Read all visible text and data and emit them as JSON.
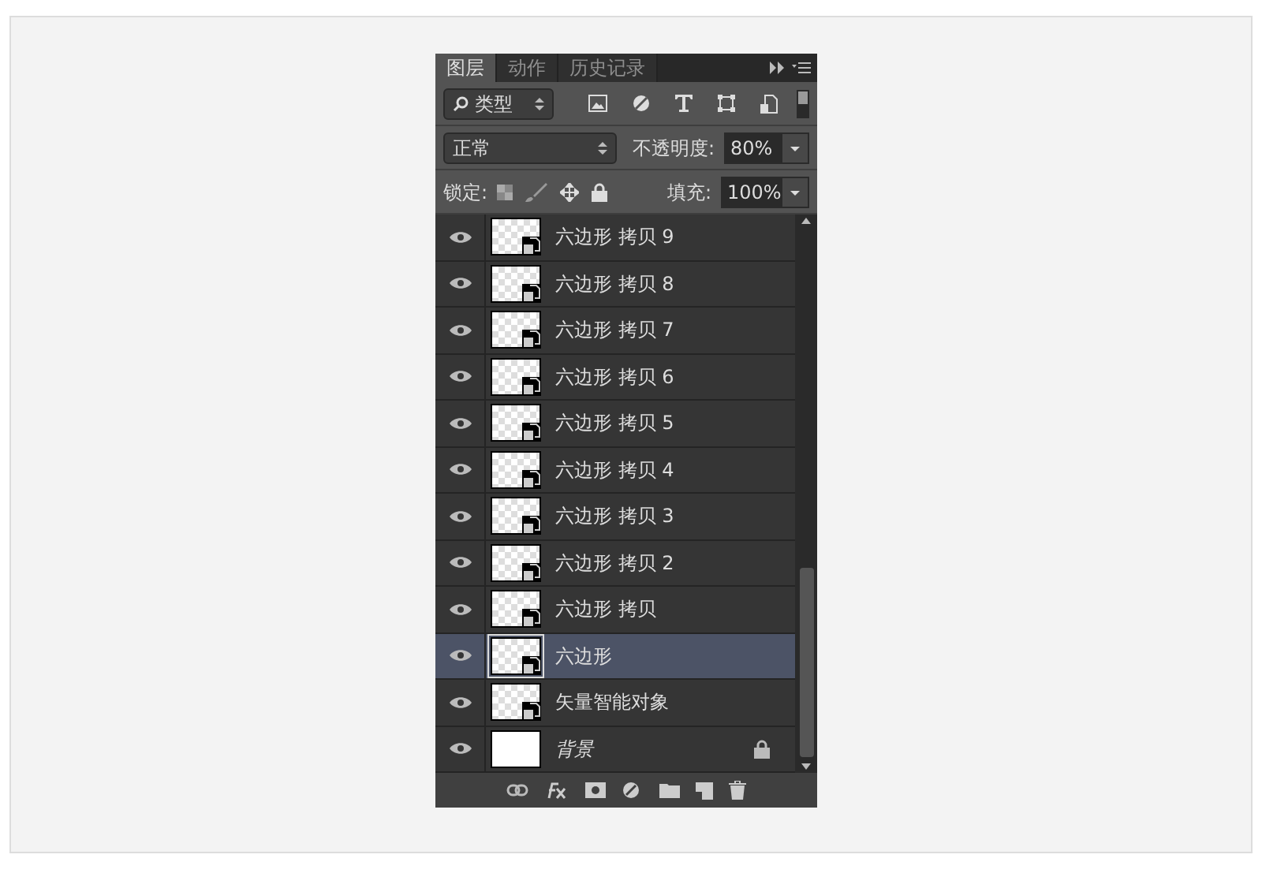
{
  "tabs": [
    {
      "label": "图层",
      "selected": true
    },
    {
      "label": "动作",
      "selected": false
    },
    {
      "label": "历史记录",
      "selected": false
    }
  ],
  "filter": {
    "value": "类型"
  },
  "blend": {
    "mode": "正常",
    "opacity_label": "不透明度:",
    "opacity": "80%"
  },
  "lock": {
    "label": "锁定:",
    "fill_label": "填充:",
    "fill": "100%"
  },
  "layers": [
    {
      "name": "六边形 拷贝 9",
      "kind": "smart",
      "visible": true,
      "selected": false,
      "locked": false
    },
    {
      "name": "六边形 拷贝 8",
      "kind": "smart",
      "visible": true,
      "selected": false,
      "locked": false
    },
    {
      "name": "六边形 拷贝 7",
      "kind": "smart",
      "visible": true,
      "selected": false,
      "locked": false
    },
    {
      "name": "六边形 拷贝 6",
      "kind": "smart",
      "visible": true,
      "selected": false,
      "locked": false
    },
    {
      "name": "六边形 拷贝 5",
      "kind": "smart",
      "visible": true,
      "selected": false,
      "locked": false
    },
    {
      "name": "六边形 拷贝 4",
      "kind": "smart",
      "visible": true,
      "selected": false,
      "locked": false
    },
    {
      "name": "六边形 拷贝 3",
      "kind": "smart",
      "visible": true,
      "selected": false,
      "locked": false
    },
    {
      "name": "六边形 拷贝 2",
      "kind": "smart",
      "visible": true,
      "selected": false,
      "locked": false
    },
    {
      "name": "六边形 拷贝",
      "kind": "smart",
      "visible": true,
      "selected": false,
      "locked": false
    },
    {
      "name": "六边形",
      "kind": "smart",
      "visible": true,
      "selected": true,
      "locked": false
    },
    {
      "name": "矢量智能对象",
      "kind": "smart",
      "visible": true,
      "selected": false,
      "locked": false
    },
    {
      "name": "背景",
      "kind": "background",
      "visible": true,
      "selected": false,
      "locked": true
    }
  ]
}
